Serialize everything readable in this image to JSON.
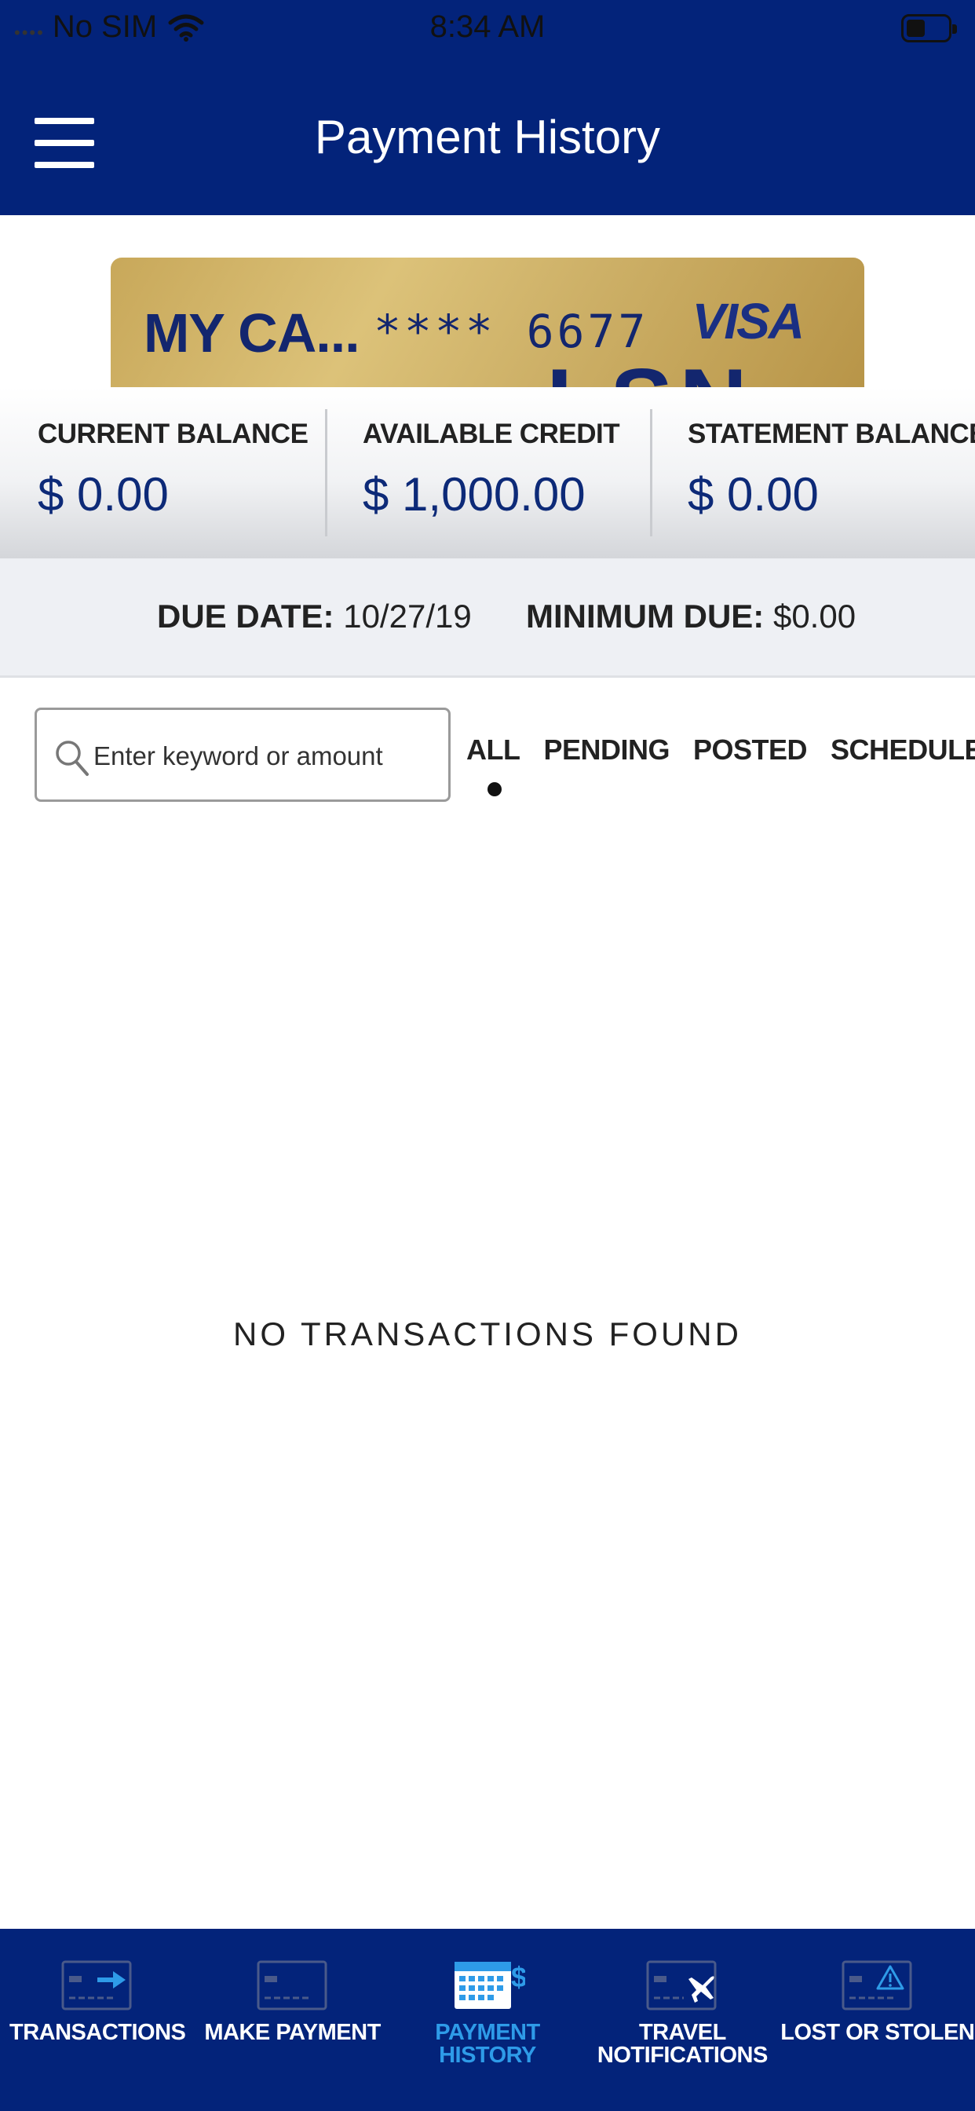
{
  "status_bar": {
    "carrier": "No SIM",
    "time": "8:34 AM"
  },
  "header": {
    "title": "Payment History"
  },
  "card": {
    "nickname": "MY CA...",
    "masked_number": "**** 6677",
    "brand": "VISA",
    "partial_number": "LSN"
  },
  "balances": [
    {
      "label": "CURRENT BALANCE",
      "value": "$ 0.00"
    },
    {
      "label": "AVAILABLE CREDIT",
      "value": "$ 1,000.00"
    },
    {
      "label": "STATEMENT BALANCE",
      "value": "$ 0.00"
    }
  ],
  "due": {
    "date_label": "DUE DATE:",
    "date_value": "10/27/19",
    "min_label": "MINIMUM DUE:",
    "min_value": "$0.00"
  },
  "search": {
    "placeholder": "Enter keyword or amount"
  },
  "filters": [
    "ALL",
    "PENDING",
    "POSTED",
    "SCHEDULED"
  ],
  "active_filter": "ALL",
  "empty_message": "NO TRANSACTIONS FOUND",
  "bottom_nav": [
    {
      "label": "TRANSACTIONS",
      "icon": "card-arrow-icon"
    },
    {
      "label": "MAKE PAYMENT",
      "icon": "card-icon"
    },
    {
      "label": "PAYMENT\nHISTORY",
      "icon": "calendar-dollar-icon",
      "active": true
    },
    {
      "label": "TRAVEL\nNOTIFICATIONS",
      "icon": "card-airplane-icon"
    },
    {
      "label": "LOST OR STOLEN",
      "icon": "card-warning-icon"
    }
  ],
  "colors": {
    "primary": "#03237a",
    "active_nav": "#2e9be8",
    "balance_text": "#0d2a78"
  }
}
